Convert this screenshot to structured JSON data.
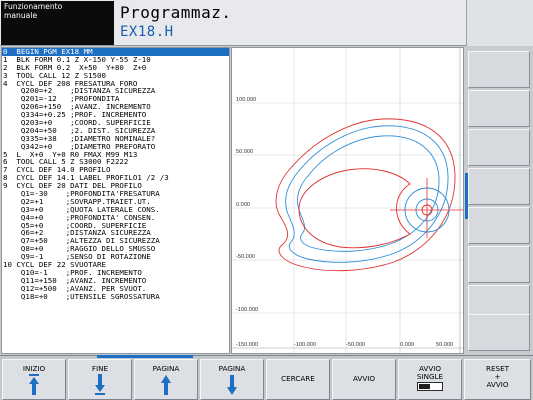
{
  "header": {
    "mode_line1": "Funzionamento",
    "mode_line2": "manuale",
    "title": "Programmaz.",
    "filename": "EX18.H"
  },
  "program": {
    "lines": [
      "0  BEGIN PGM EX18 MM",
      "1  BLK FORM 0.1 Z X-150 Y-55 Z-10",
      "2  BLK FORM 0.2  X+50  Y+80  Z+0",
      "3  TOOL CALL 12 Z S1500",
      "4  CYCL DEF 208 FRESATURA FORO",
      "    Q200=+2    ;DISTANZA SICUREZZA",
      "    Q201=-12   ;PROFONDITA",
      "    Q206=+150  ;AVANZ. INCREMENTO",
      "    Q334=+0.25 ;PROF. INCREMENTO",
      "    Q203=+0    ;COORD. SUPERFICIE",
      "    Q204=+50   ;2. DIST. SICUREZZA",
      "    Q335=+38   ;DIAMETRO NOMINALE?",
      "    Q342=+0    ;DIAMETRO PREFORATO",
      "5  L  X+0  Y+0 R0 FMAX M99 M13",
      "6  TOOL CALL 5 Z S3000 F2222",
      "7  CYCL DEF 14.0 PROFILO",
      "8  CYCL DEF 14.1 LABEL PROFILO1 /2 /3",
      "9  CYCL DEF 20 DATI DEL PROFILO",
      "    Q1=-30    ;PROFONDITA'FRESATURA",
      "    Q2=+1     ;SOVRAPP.TRAIET.UT.",
      "    Q3=+0     ;QUOTA LATERALE CONS.",
      "    Q4=+0     ;PROFONDITA' CONSEN.",
      "    Q5=+0     ;COORD. SUPERFICIE",
      "    Q6=+2     ;DISTANZA SICUREZZA",
      "    Q7=+50    ;ALTEZZA DI SICUREZZA",
      "    Q8=+0     ;RAGGIO DELLO SMUSSO",
      "    Q9=-1     ;SENSO DI ROTAZIONE",
      "10 CYCL DEF 22 SVUOTARE",
      "    Q10=-1    ;PROF. INCREMENTO",
      "    Q11=+150  ;AVANZ. INCREMENTO",
      "    Q12=+500  ;AVANZ. PER SVUOT.",
      "    Q18=+0    ;UTENSILE SGROSSATURA"
    ]
  },
  "graphic": {
    "y_labels": [
      "100.000",
      "50.000",
      "0.000",
      "-50.000",
      "-100.000"
    ],
    "x_labels": [
      "-150.000",
      "-100.000",
      "-50.000",
      "0.000",
      "50.000"
    ],
    "colors": {
      "contour": "#e03030",
      "toolpath": "#2f8fd6",
      "grid": "#d2d6dc"
    }
  },
  "softkeys": {
    "k1": "INIZIO",
    "k2": "FINE",
    "k3": "PAGINA",
    "k4": "PAGINA",
    "k5": "CERCARE",
    "k6": "AVVIO",
    "k7_line1": "AVVIO",
    "k7_line2": "SINGLE",
    "k8_line1": "RESET",
    "k8_line2": "+",
    "k8_line3": "AVVIO"
  }
}
